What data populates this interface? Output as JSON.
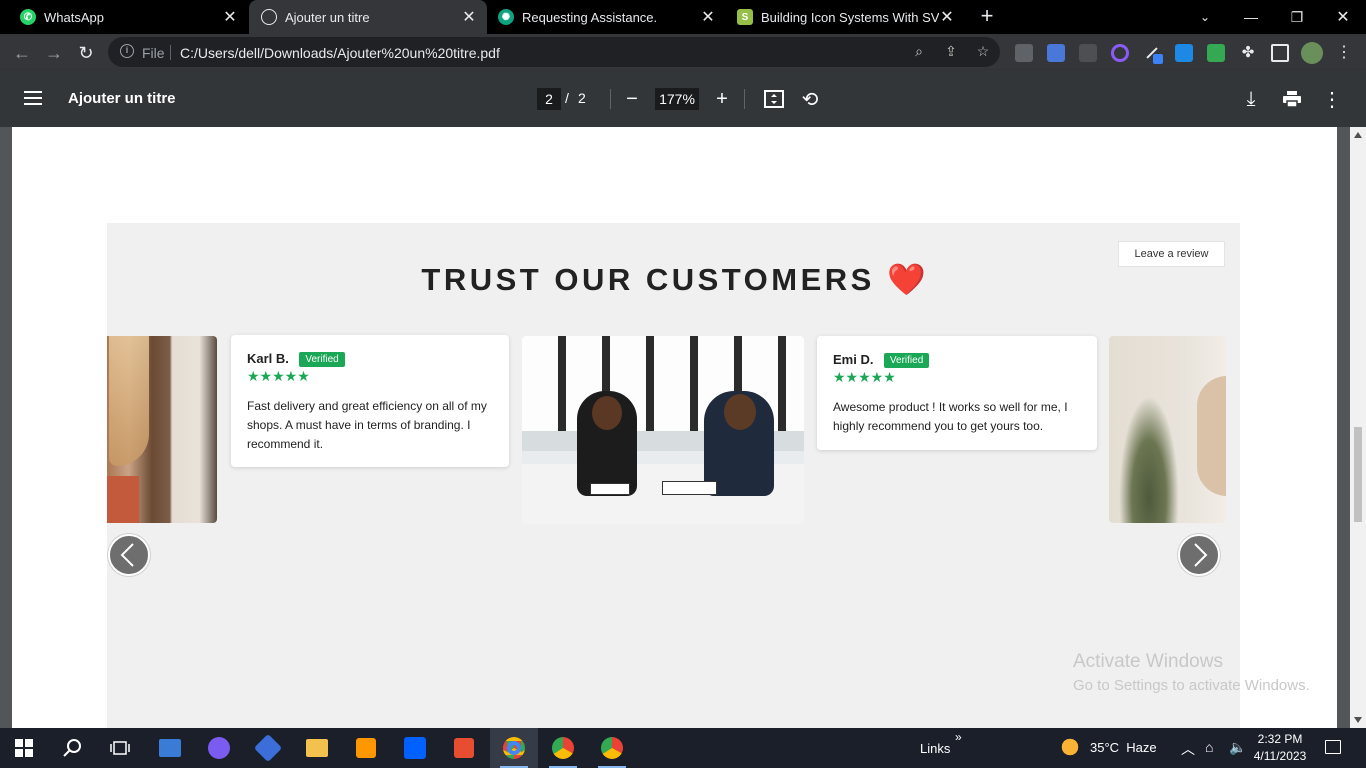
{
  "browser": {
    "tabs": [
      {
        "label": "WhatsApp",
        "favicon": "whatsapp-icon",
        "color": "#25d366"
      },
      {
        "label": "Ajouter un titre",
        "favicon": "globe-icon",
        "color": "#9aa0a6",
        "active": true
      },
      {
        "label": "Requesting Assistance.",
        "favicon": "chatgpt-icon",
        "color": "#10a37f"
      },
      {
        "label": "Building Icon Systems With SVG",
        "favicon": "shopify-icon",
        "color": "#95bf47"
      }
    ],
    "address": {
      "scheme": "File",
      "url": "C:/Users/dell/Downloads/Ajouter%20un%20titre.pdf"
    }
  },
  "pdf_viewer": {
    "title": "Ajouter un titre",
    "current_page": "2",
    "separator": "/",
    "total_pages": "2",
    "zoom": "177%"
  },
  "page": {
    "leave_review_label": "Leave a review",
    "heading": "TRUST OUR CUSTOMERS",
    "heading_emoji": "❤️",
    "reviews": [
      {
        "name": "Karl B.",
        "badge": "Verified",
        "stars": "★★★★★",
        "rating": 5,
        "text": "Fast delivery and great efficiency on all of my shops. A must have in terms of branding. I recommend it."
      },
      {
        "name": "Emi D.",
        "badge": "Verified",
        "stars": "★★★★★",
        "rating": 5,
        "text": "Awesome product ! It works so well for me, I highly recommend you to get yours too."
      }
    ]
  },
  "watermark": {
    "line1": "Activate Windows",
    "line2": "Go to Settings to activate Windows."
  },
  "taskbar": {
    "links_label": "Links",
    "chevron": "»",
    "weather": "35°C  Haze",
    "time": "2:32 PM",
    "date": "4/11/2023"
  },
  "colors": {
    "accent_green": "#1aa856",
    "heart_red": "#e21b2b",
    "section_bg": "#f0f0f0"
  }
}
